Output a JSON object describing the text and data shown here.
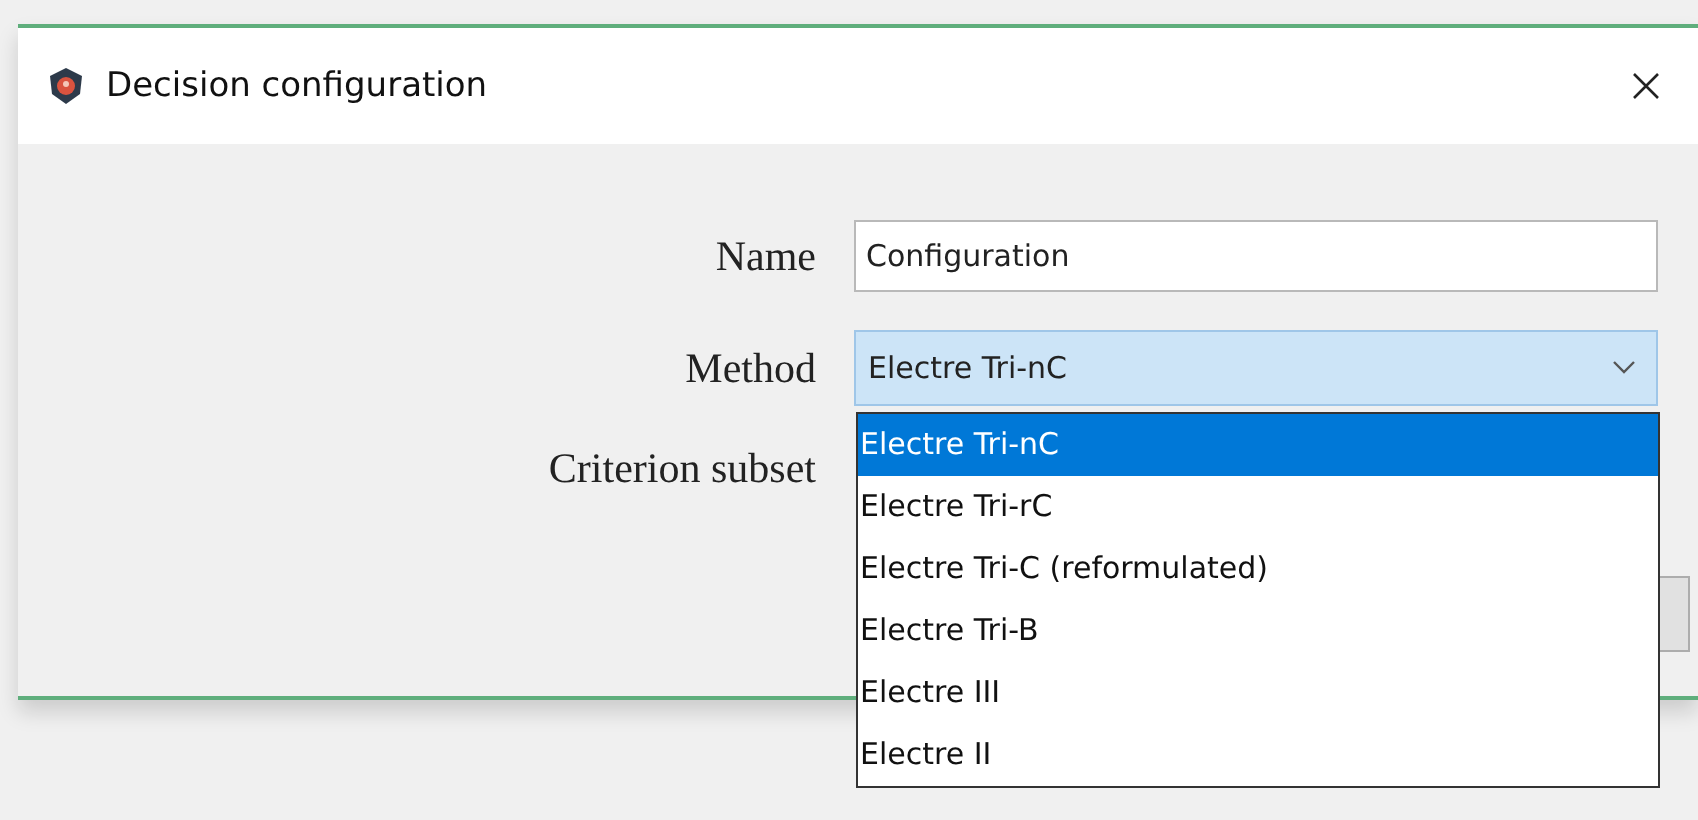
{
  "window": {
    "title": "Decision configuration"
  },
  "form": {
    "name_label": "Name",
    "name_value": "Configuration",
    "method_label": "Method",
    "method_value": "Electre Tri-nC",
    "method_expanded": true,
    "criterion_label": "Criterion subset"
  },
  "dropdown": {
    "options": [
      {
        "label": "Electre Tri-nC",
        "selected": true
      },
      {
        "label": "Electre Tri-rC",
        "selected": false
      },
      {
        "label": "Electre Tri-C (reformulated)",
        "selected": false
      },
      {
        "label": "Electre Tri-B",
        "selected": false
      },
      {
        "label": "Electre III",
        "selected": false
      },
      {
        "label": "Electre II",
        "selected": false
      }
    ]
  }
}
